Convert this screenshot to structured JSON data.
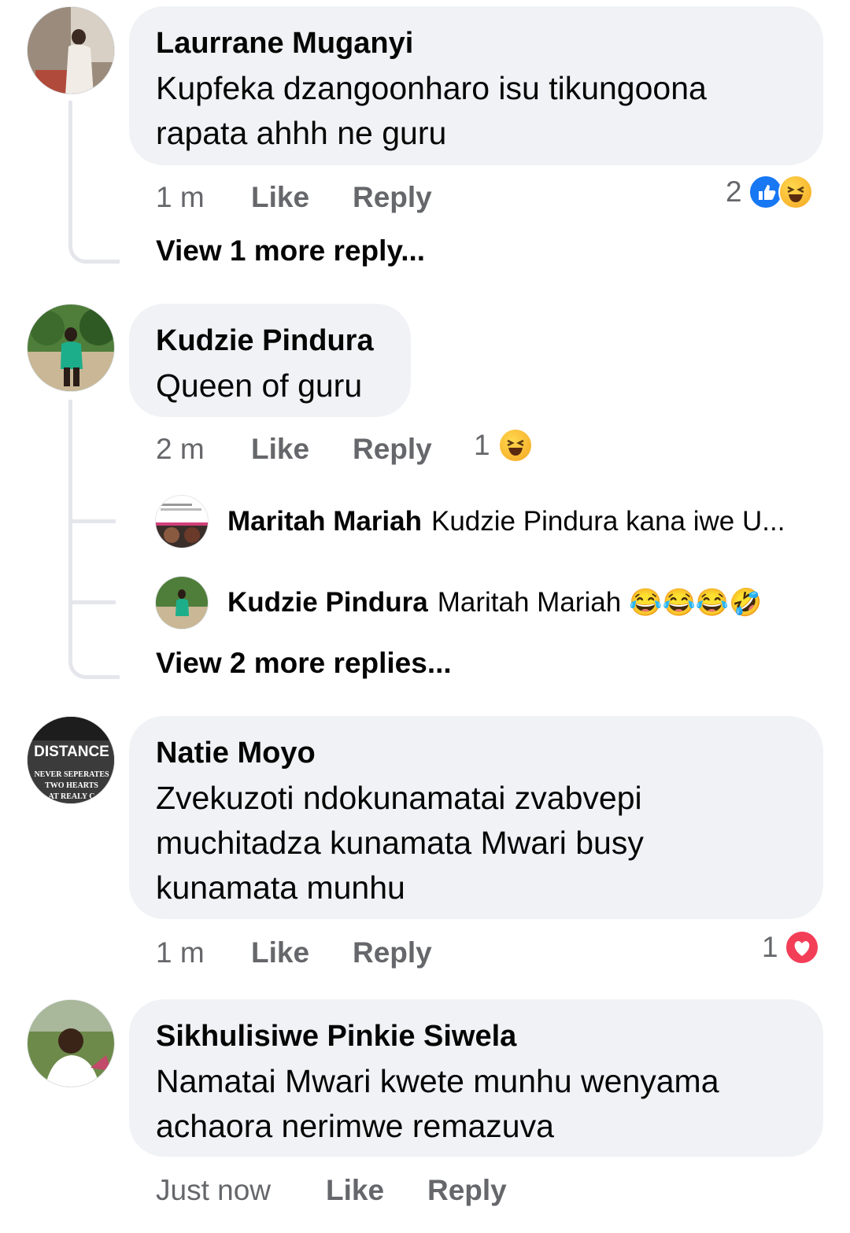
{
  "comments": [
    {
      "name": "Laurrane Muganyi",
      "text": "Kupfeka dzangoonharo isu tikungoona rapata ahhh ne guru",
      "time": "1 m",
      "like": "Like",
      "reply": "Reply",
      "reaction_count": "2",
      "reactions": [
        "like-icon",
        "haha-icon"
      ],
      "view_more": "View 1 more reply..."
    },
    {
      "name": "Kudzie Pindura",
      "text": "Queen of guru",
      "time": "2 m",
      "like": "Like",
      "reply": "Reply",
      "reaction_count": "1",
      "reactions": [
        "haha-icon"
      ],
      "replies": [
        {
          "name": "Maritah Mariah",
          "text": "Kudzie Pindura kana iwe U..."
        },
        {
          "name": "Kudzie Pindura",
          "text": "Maritah Mariah",
          "emojis": "😂😂😂🤣"
        }
      ],
      "view_more": "View 2 more replies..."
    },
    {
      "name": "Natie Moyo",
      "text": "Zvekuzoti ndokunamatai zvabvepi muchitadza kunamata Mwari busy kunamata munhu",
      "time": "1 m",
      "like": "Like",
      "reply": "Reply",
      "reaction_count": "1",
      "reactions": [
        "love-icon"
      ],
      "avatar_text": [
        "DISTANCE",
        "NEVER SEPERATES",
        "TWO HEARTS",
        "AT REALY C"
      ]
    },
    {
      "name": "Sikhulisiwe Pinkie Siwela",
      "text": "Namatai Mwari kwete munhu wenyama achaora nerimwe remazuva",
      "time": "Just now",
      "like": "Like",
      "reply": "Reply"
    }
  ],
  "colors": {
    "bubble": "#f0f2f5",
    "meta": "#65676b",
    "thread_line": "#e4e6eb",
    "like_blue": "#1877f2",
    "love_red": "#f33e58"
  }
}
